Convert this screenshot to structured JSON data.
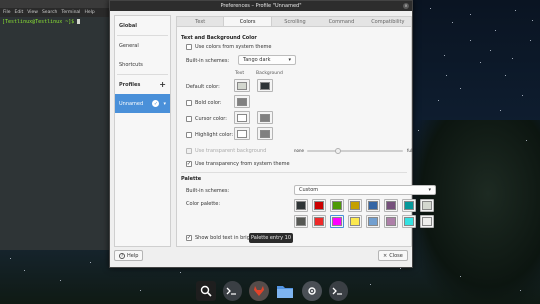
{
  "terminal": {
    "menu": [
      "File",
      "Edit",
      "View",
      "Search",
      "Terminal",
      "Help"
    ],
    "prompt": "[Testlinux@Testlinux ~]$ "
  },
  "dialog": {
    "title": "Preferences – Profile \"Unnamed\"",
    "sidebar": {
      "global": "Global",
      "general": "General",
      "shortcuts": "Shortcuts",
      "profiles": "Profiles",
      "profiles_add": "+",
      "unnamed": "Unnamed",
      "unnamed_check": "✓",
      "unnamed_menu": "▾"
    },
    "tabs": [
      "Text",
      "Colors",
      "Scrolling",
      "Command",
      "Compatibility"
    ],
    "text_bg": {
      "heading": "Text and Background Color",
      "use_system_colors": "Use colors from system theme",
      "builtin_label": "Built-in schemes:",
      "builtin_value": "Tango dark",
      "col_text": "Text",
      "col_background": "Background",
      "default_color": "Default color:",
      "bold_color": "Bold color:",
      "cursor_color": "Cursor color:",
      "highlight_color": "Highlight color:",
      "transparent_bg": "Use transparent background",
      "slider_none": "none",
      "slider_full": "full",
      "transparency_system": "Use transparency from system theme"
    },
    "palette": {
      "heading": "Palette",
      "builtin_label": "Built-in schemes:",
      "builtin_value": "Custom",
      "palette_label": "Color palette:",
      "row1": [
        "#2e3436",
        "#cc0000",
        "#4e9a06",
        "#c4a000",
        "#3465a4",
        "#75507b",
        "#06989a",
        "#d3d7cf"
      ],
      "row2": [
        "#555753",
        "#ef2929",
        "#ff00ff",
        "#fce94f",
        "#729fcf",
        "#ad7fa8",
        "#34e2e2",
        "#eeeeec"
      ],
      "bright_bold": "Show bold text in bright colors",
      "tooltip": "Palette entry 10"
    },
    "help": "Help",
    "close": "Close"
  },
  "colors": {
    "default_text": "#d3d7cf",
    "default_bg": "#2e3436",
    "bold": "#808080",
    "cursor_text": "#ffffff",
    "cursor_bg": "#808080",
    "highlight_text": "#ffffff",
    "highlight_bg": "#808080",
    "accent": "#4a90d9"
  },
  "dock": [
    "search-icon",
    "terminal-icon",
    "gitlab-icon",
    "folder-icon",
    "settings-icon",
    "terminal-icon"
  ]
}
